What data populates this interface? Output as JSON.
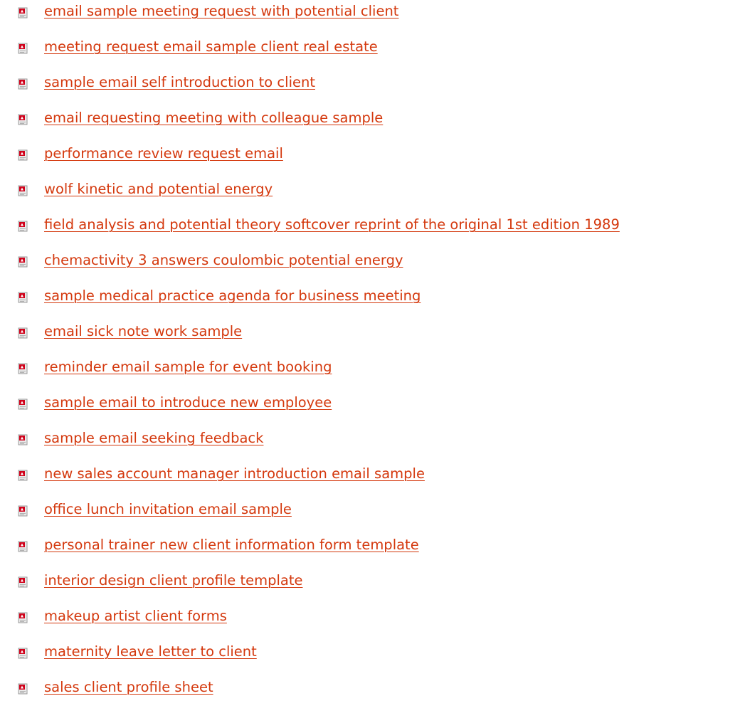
{
  "colors": {
    "link": "#d4380d",
    "icon_red": "#d0021b",
    "icon_page": "#e9e9e9"
  },
  "icon_name": "pdf-file-icon",
  "documents": [
    {
      "title": "email sample meeting request with potential client"
    },
    {
      "title": "meeting request email sample client real estate"
    },
    {
      "title": "sample email self introduction to client"
    },
    {
      "title": "email requesting meeting with colleague sample"
    },
    {
      "title": "performance review request email"
    },
    {
      "title": "wolf kinetic and potential energy"
    },
    {
      "title": "field analysis and potential theory softcover reprint of the original 1st edition 1989"
    },
    {
      "title": "chemactivity 3 answers coulombic potential energy"
    },
    {
      "title": "sample medical practice agenda for business meeting"
    },
    {
      "title": "email sick note work sample"
    },
    {
      "title": "reminder email sample for event booking"
    },
    {
      "title": "sample email to introduce new employee"
    },
    {
      "title": "sample email seeking feedback"
    },
    {
      "title": "new sales account manager introduction email sample"
    },
    {
      "title": "office lunch invitation email sample"
    },
    {
      "title": "personal trainer new client information form template"
    },
    {
      "title": "interior design client profile template"
    },
    {
      "title": "makeup artist client forms"
    },
    {
      "title": "maternity leave letter to client"
    },
    {
      "title": "sales client profile sheet"
    }
  ]
}
